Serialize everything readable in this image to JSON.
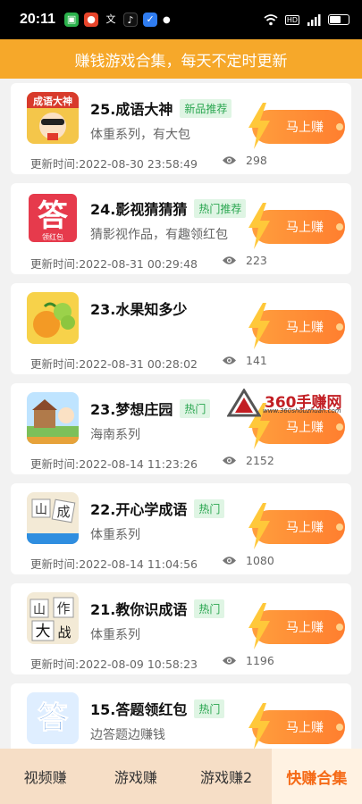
{
  "status": {
    "time": "20:11",
    "left_icons": [
      "app-icon-1",
      "app-icon-2",
      "app-icon-3",
      "tiktok-icon",
      "shield-icon",
      "dot-icon"
    ],
    "right_icons": [
      "wifi-icon",
      "hd-icon",
      "signal-icon",
      "battery-icon"
    ],
    "hd_label": "HD"
  },
  "banner": {
    "text": "赚钱游戏合集，每天不定时更新"
  },
  "accent": "#f6a82a",
  "button_color": "#ff8a35",
  "items": [
    {
      "title": "25.成语大神",
      "tag": "新品推荐",
      "subtitle": "体重系列，有大包",
      "time": "更新时间:2022-08-30 23:58:49",
      "views": "298",
      "button": "马上赚",
      "thumb": "chengyu-dashen-thumb"
    },
    {
      "title": "24.影视猜猜猜",
      "tag": "热门推荐",
      "subtitle": "猜影视作品，有趣领红包",
      "time": "更新时间:2022-08-31 00:29:48",
      "views": "223",
      "button": "马上赚",
      "thumb": "da-red-thumb"
    },
    {
      "title": "23.水果知多少",
      "tag": "",
      "subtitle": "",
      "time": "更新时间:2022-08-31 00:28:02",
      "views": "141",
      "button": "马上赚",
      "thumb": "fruit-thumb"
    },
    {
      "title": "23.梦想庄园",
      "tag": "热门",
      "subtitle": "海南系列",
      "time": "更新时间:2022-08-14 11:23:26",
      "views": "2152",
      "button": "马上赚",
      "thumb": "farm-thumb"
    },
    {
      "title": "22.开心学成语",
      "tag": "热门",
      "subtitle": "体重系列",
      "time": "更新时间:2022-08-14 11:04:56",
      "views": "1080",
      "button": "马上赚",
      "thumb": "idiom-thumb"
    },
    {
      "title": "21.教你识成语",
      "tag": "热门",
      "subtitle": "体重系列",
      "time": "更新时间:2022-08-09 10:58:23",
      "views": "1196",
      "button": "马上赚",
      "thumb": "idiom2-thumb"
    },
    {
      "title": "15.答题领红包",
      "tag": "热门",
      "subtitle": "边答题边赚钱",
      "time": "",
      "views": "",
      "button": "马上赚",
      "thumb": "da-blue-thumb"
    }
  ],
  "watermark": {
    "text": "360手赚网",
    "url": "www.360shouzhuan.com"
  },
  "tabs": [
    {
      "label": "视频赚",
      "active": false
    },
    {
      "label": "游戏赚",
      "active": false
    },
    {
      "label": "游戏赚2",
      "active": false
    },
    {
      "label": "快赚合集",
      "active": true
    }
  ]
}
